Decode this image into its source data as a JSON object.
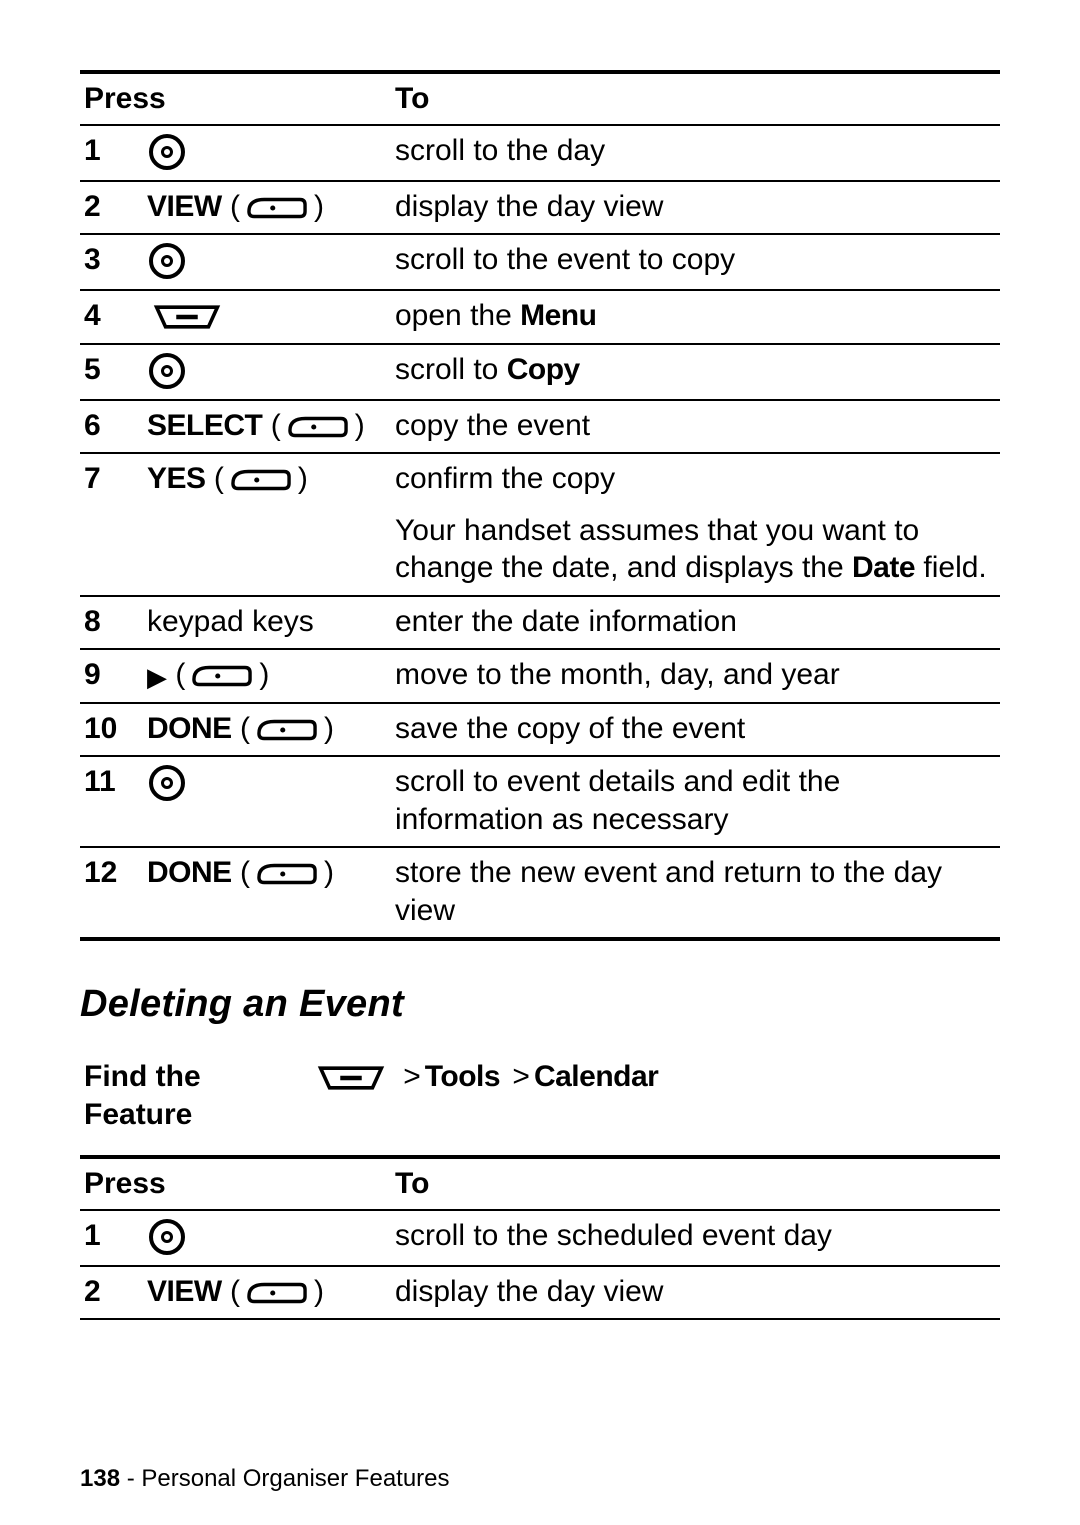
{
  "table1": {
    "header": {
      "press": "Press",
      "to": "To"
    },
    "rows": [
      {
        "num": "1",
        "press_label": "",
        "icon": "scroll",
        "to": "scroll to the day"
      },
      {
        "num": "2",
        "press_label": "VIEW",
        "icon": "softkey",
        "to": "display the day view"
      },
      {
        "num": "3",
        "press_label": "",
        "icon": "scroll",
        "to": "scroll to the event to copy"
      },
      {
        "num": "4",
        "press_label": "",
        "icon": "menu",
        "to_pre": "open the ",
        "to_bold": "Menu",
        "to_post": ""
      },
      {
        "num": "5",
        "press_label": "",
        "icon": "scroll",
        "to_pre": "scroll to ",
        "to_bold": "Copy",
        "to_post": ""
      },
      {
        "num": "6",
        "press_label": "SELECT",
        "icon": "softkey",
        "to": "copy the event"
      },
      {
        "num": "7",
        "press_label": "YES",
        "icon": "softkey",
        "to": "confirm the copy"
      },
      {
        "num": "",
        "press_label": "",
        "icon": "",
        "to_pre": "Your handset assumes that you want to change the date, and displays the ",
        "to_bold": "Date",
        "to_post": " field."
      },
      {
        "num": "8",
        "press_label": "keypad keys",
        "icon": "",
        "to": "enter the date information"
      },
      {
        "num": "9",
        "press_label": "",
        "icon": "right-softkey",
        "to": "move to the month, day, and year"
      },
      {
        "num": "10",
        "press_label": "DONE",
        "icon": "softkey",
        "to": "save the copy of the event"
      },
      {
        "num": "11",
        "press_label": "",
        "icon": "scroll",
        "to": "scroll to event details and edit the information as necessary"
      },
      {
        "num": "12",
        "press_label": "DONE",
        "icon": "softkey",
        "to": "store the new event and return to the day view"
      }
    ]
  },
  "section_title": "Deleting an Event",
  "find_the_feature": {
    "label": "Find the Feature",
    "crumb1": "Tools",
    "crumb2": "Calendar"
  },
  "table2": {
    "header": {
      "press": "Press",
      "to": "To"
    },
    "rows": [
      {
        "num": "1",
        "press_label": "",
        "icon": "scroll",
        "to": "scroll to the scheduled event day"
      },
      {
        "num": "2",
        "press_label": "VIEW",
        "icon": "softkey",
        "to": "display the day view"
      }
    ]
  },
  "footer": {
    "page": "138",
    "sep": " - ",
    "section": "Personal Organiser Features"
  }
}
